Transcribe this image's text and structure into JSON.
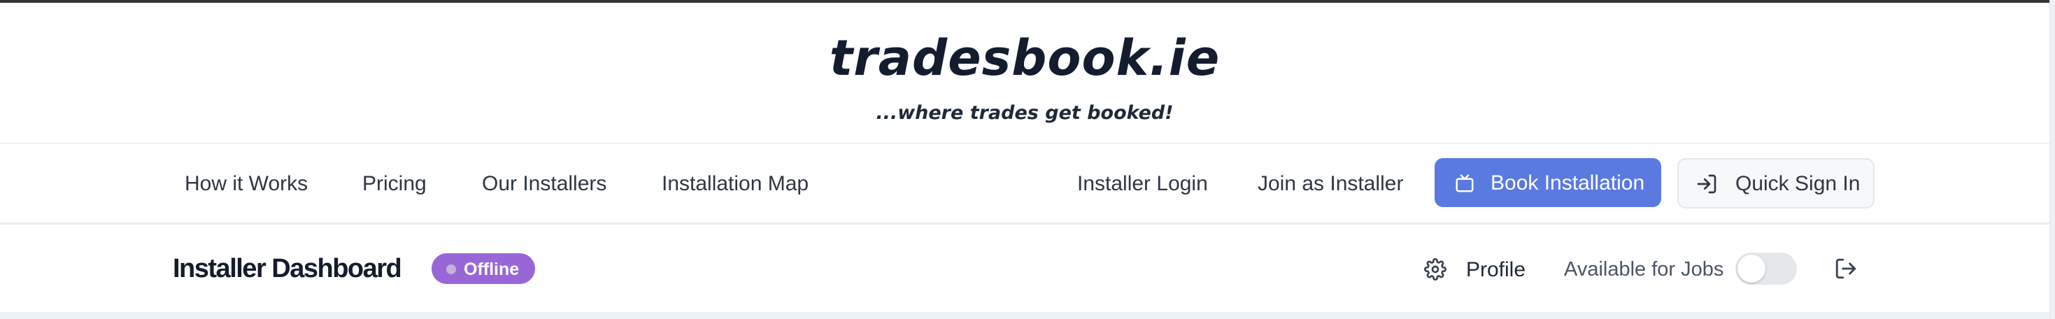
{
  "brand": {
    "logo_text": "tradesbook.ie",
    "tagline": "...where trades get booked!"
  },
  "nav": {
    "links": [
      {
        "label": "How it Works"
      },
      {
        "label": "Pricing"
      },
      {
        "label": "Our Installers"
      },
      {
        "label": "Installation Map"
      }
    ],
    "installer_login": "Installer Login",
    "join_installer": "Join as Installer",
    "book_button": {
      "label": "Book Installation",
      "icon": "tv-icon"
    },
    "quick_sign_in": {
      "label": "Quick Sign In",
      "icon": "sign-in-icon"
    }
  },
  "dashboard": {
    "title": "Installer Dashboard",
    "status_badge": "Offline",
    "profile_label": "Profile",
    "profile_icon": "gear-icon",
    "availability_label": "Available for Jobs",
    "availability_on": false,
    "logout_icon": "logout-icon"
  },
  "colors": {
    "primary_button": "#5a7ae2",
    "status_badge": "#9966d8",
    "heading": "#141c2e"
  }
}
